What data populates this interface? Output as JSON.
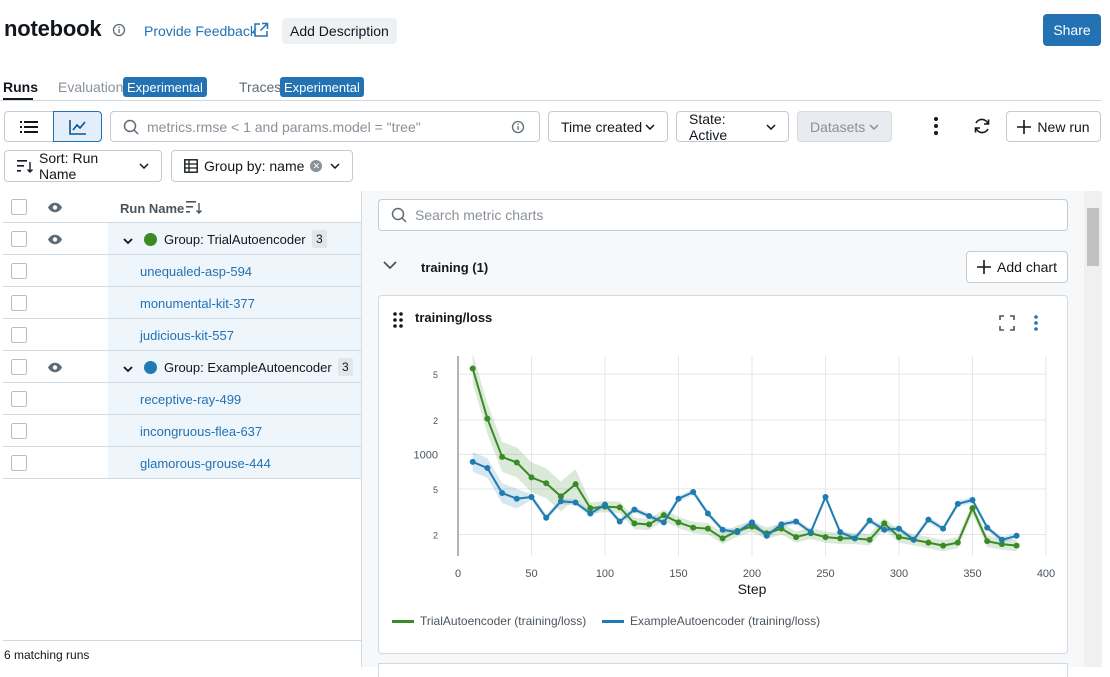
{
  "header": {
    "title": "notebook",
    "feedback": "Provide Feedback",
    "add_description": "Add Description",
    "share": "Share"
  },
  "tabs": {
    "runs": "Runs",
    "evaluation": "Evaluation",
    "evaluation_badge": "Experimental",
    "traces": "Traces",
    "traces_badge": "Experimental"
  },
  "toolbar": {
    "search_placeholder": "metrics.rmse < 1 and params.model = \"tree\"",
    "time_created": "Time created",
    "state": "State: Active",
    "datasets": "Datasets",
    "new_run": "New run",
    "sort": "Sort: Run Name",
    "group": "Group by: name"
  },
  "table": {
    "header_name": "Run Name",
    "rows": [
      {
        "type": "group",
        "label": "Group: TrialAutoencoder",
        "count": "3",
        "color": "#3a8a25"
      },
      {
        "type": "run",
        "label": "unequaled-asp-594"
      },
      {
        "type": "run",
        "label": "monumental-kit-377"
      },
      {
        "type": "run",
        "label": "judicious-kit-557"
      },
      {
        "type": "group",
        "label": "Group: ExampleAutoencoder",
        "count": "3",
        "color": "#1f7cb0"
      },
      {
        "type": "run",
        "label": "receptive-ray-499"
      },
      {
        "type": "run",
        "label": "incongruous-flea-637"
      },
      {
        "type": "run",
        "label": "glamorous-grouse-444"
      }
    ],
    "matching": "6 matching runs"
  },
  "charts_panel": {
    "search_placeholder": "Search metric charts",
    "section_title": "training (1)",
    "add_chart": "Add chart",
    "card_title": "training/loss"
  },
  "chart_data": {
    "type": "line",
    "title": "training/loss",
    "xlabel": "Step",
    "ylabel": "",
    "xlim": [
      0,
      400
    ],
    "yscale": "log",
    "x_ticks": [
      "0",
      "50",
      "100",
      "150",
      "200",
      "250",
      "300",
      "350",
      "400"
    ],
    "y_ticks": [
      {
        "value": 200,
        "label": "2"
      },
      {
        "value": 500,
        "label": "5"
      },
      {
        "value": 1000,
        "label": "1000"
      },
      {
        "value": 2000,
        "label": "2"
      },
      {
        "value": 5000,
        "label": "5"
      }
    ],
    "grid": true,
    "legend": "bottom",
    "series": [
      {
        "name": "TrialAutoencoder (training/loss)",
        "color": "#3a8a25",
        "x": [
          10,
          20,
          30,
          40,
          50,
          60,
          70,
          80,
          90,
          100,
          110,
          120,
          130,
          140,
          150,
          160,
          170,
          180,
          190,
          200,
          210,
          220,
          230,
          240,
          250,
          260,
          270,
          280,
          290,
          300,
          310,
          320,
          330,
          340,
          350,
          360,
          370,
          380
        ],
        "y": [
          5600,
          2050,
          950,
          850,
          630,
          560,
          430,
          550,
          340,
          350,
          345,
          250,
          245,
          295,
          255,
          230,
          225,
          185,
          215,
          235,
          205,
          225,
          190,
          205,
          190,
          185,
          185,
          180,
          250,
          190,
          180,
          170,
          160,
          170,
          340,
          175,
          165,
          160
        ]
      },
      {
        "name": "ExampleAutoencoder (training/loss)",
        "color": "#1f7cb0",
        "x": [
          10,
          20,
          30,
          40,
          50,
          60,
          70,
          80,
          90,
          100,
          110,
          120,
          130,
          140,
          150,
          160,
          170,
          180,
          190,
          200,
          210,
          220,
          230,
          240,
          250,
          260,
          270,
          280,
          290,
          300,
          310,
          320,
          330,
          340,
          350,
          360,
          370,
          380
        ],
        "y": [
          860,
          760,
          460,
          410,
          425,
          280,
          390,
          380,
          305,
          365,
          260,
          330,
          290,
          255,
          410,
          470,
          305,
          220,
          210,
          255,
          195,
          245,
          260,
          210,
          425,
          210,
          185,
          265,
          220,
          225,
          180,
          270,
          225,
          370,
          400,
          230,
          180,
          195
        ]
      }
    ]
  }
}
